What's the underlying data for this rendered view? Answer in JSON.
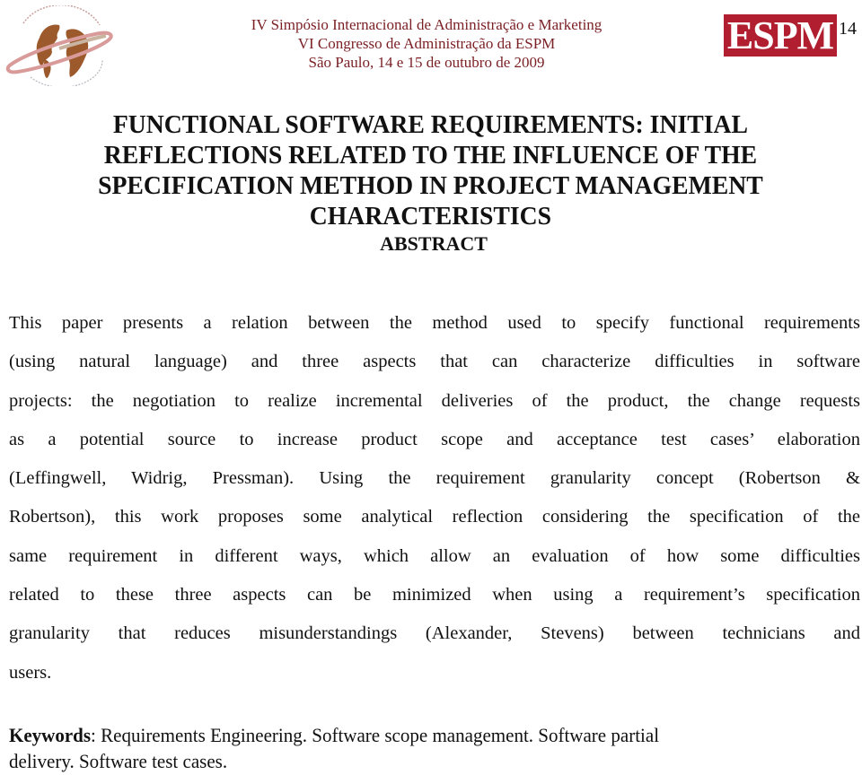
{
  "header": {
    "conference_lines": [
      "IV Simpósio Internacional de Administração e Marketing",
      "VI Congresso de Administração da ESPM",
      "São Paulo, 14 e 15 de outubro de 2009"
    ],
    "left_logo_icon": "globe-ring-logo",
    "right_logo_text": "ESPM",
    "page_number": "14",
    "colors": {
      "conference_text": "#7a1f24",
      "espm_logo_bg": "#b01e2f",
      "globe_brown": "#9c5a2c",
      "ring_pink": "#d99a9a"
    }
  },
  "title": {
    "lines": [
      "FUNCTIONAL SOFTWARE REQUIREMENTS: INITIAL",
      "REFLECTIONS RELATED TO THE INFLUENCE OF THE",
      "SPECIFICATION METHOD IN PROJECT MANAGEMENT",
      "CHARACTERISTICS"
    ]
  },
  "abstract": {
    "heading": "ABSTRACT",
    "lines": [
      "This paper presents a relation between the method used to specify functional requirements",
      "(using natural language) and three aspects that can characterize difficulties in software",
      "projects: the negotiation to realize incremental deliveries of the product, the change requests",
      "as a potential source to increase product scope and acceptance test cases’ elaboration",
      "(Leffingwell, Widrig, Pressman). Using the requirement granularity concept (Robertson &",
      "Robertson), this work proposes some analytical reflection considering the specification of the",
      "same requirement in different ways, which allow an evaluation of how some difficulties",
      "related to these three aspects can be minimized when using a requirement’s specification",
      "granularity that reduces misunderstandings (Alexander, Stevens) between technicians and",
      "users."
    ]
  },
  "keywords": {
    "label": "Keywords",
    "line1": ": Requirements Engineering. Software scope management. Software partial",
    "line2": "delivery. Software test cases."
  }
}
